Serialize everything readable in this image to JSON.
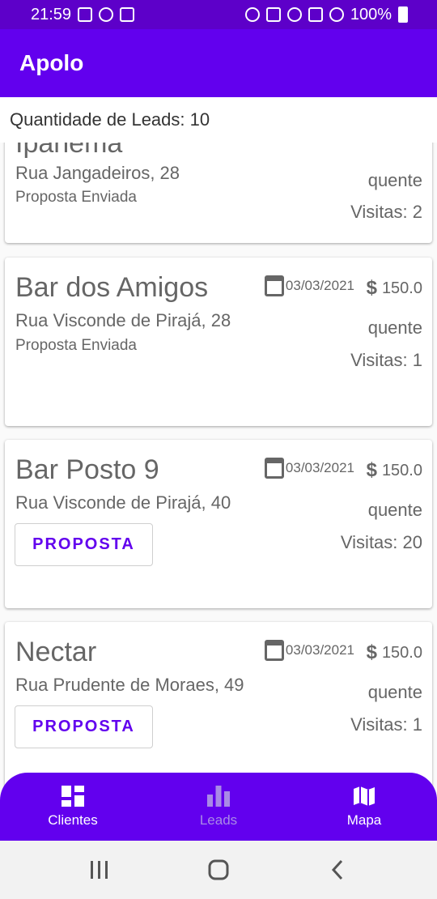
{
  "status_bar": {
    "time": "21:59",
    "battery": "100%"
  },
  "app": {
    "title": "Apolo"
  },
  "lead_count": {
    "text": "Quantidade de Leads: 10"
  },
  "leads": [
    {
      "name": "Ipanema",
      "address": "Rua Jangadeiros, 28",
      "status": "Proposta Enviada",
      "temperature": "quente",
      "visits": "Visitas: 2"
    },
    {
      "name": "Bar dos Amigos",
      "address": "Rua Visconde de Pirajá, 28",
      "status": "Proposta Enviada",
      "date": "03/03/2021",
      "price": "150.0",
      "temperature": "quente",
      "visits": "Visitas: 1"
    },
    {
      "name": "Bar Posto 9",
      "address": "Rua Visconde de Pirajá, 40",
      "button": "PROPOSTA",
      "date": "03/03/2021",
      "price": "150.0",
      "temperature": "quente",
      "visits": "Visitas: 20"
    },
    {
      "name": "Nectar",
      "address": "Rua Prudente de Moraes, 49",
      "button": "PROPOSTA",
      "date": "03/03/2021",
      "price": "150.0",
      "temperature": "quente",
      "visits": "Visitas: 1"
    }
  ],
  "bottom_nav": [
    {
      "label": "Clientes",
      "icon": "dashboard-icon",
      "active": true
    },
    {
      "label": "Leads",
      "icon": "bar-chart-icon",
      "active": false
    },
    {
      "label": "Mapa",
      "icon": "map-icon",
      "active": true
    }
  ],
  "colors": {
    "primary": "#6200ee",
    "status_bar": "#5d00c9",
    "text": "#666666"
  }
}
